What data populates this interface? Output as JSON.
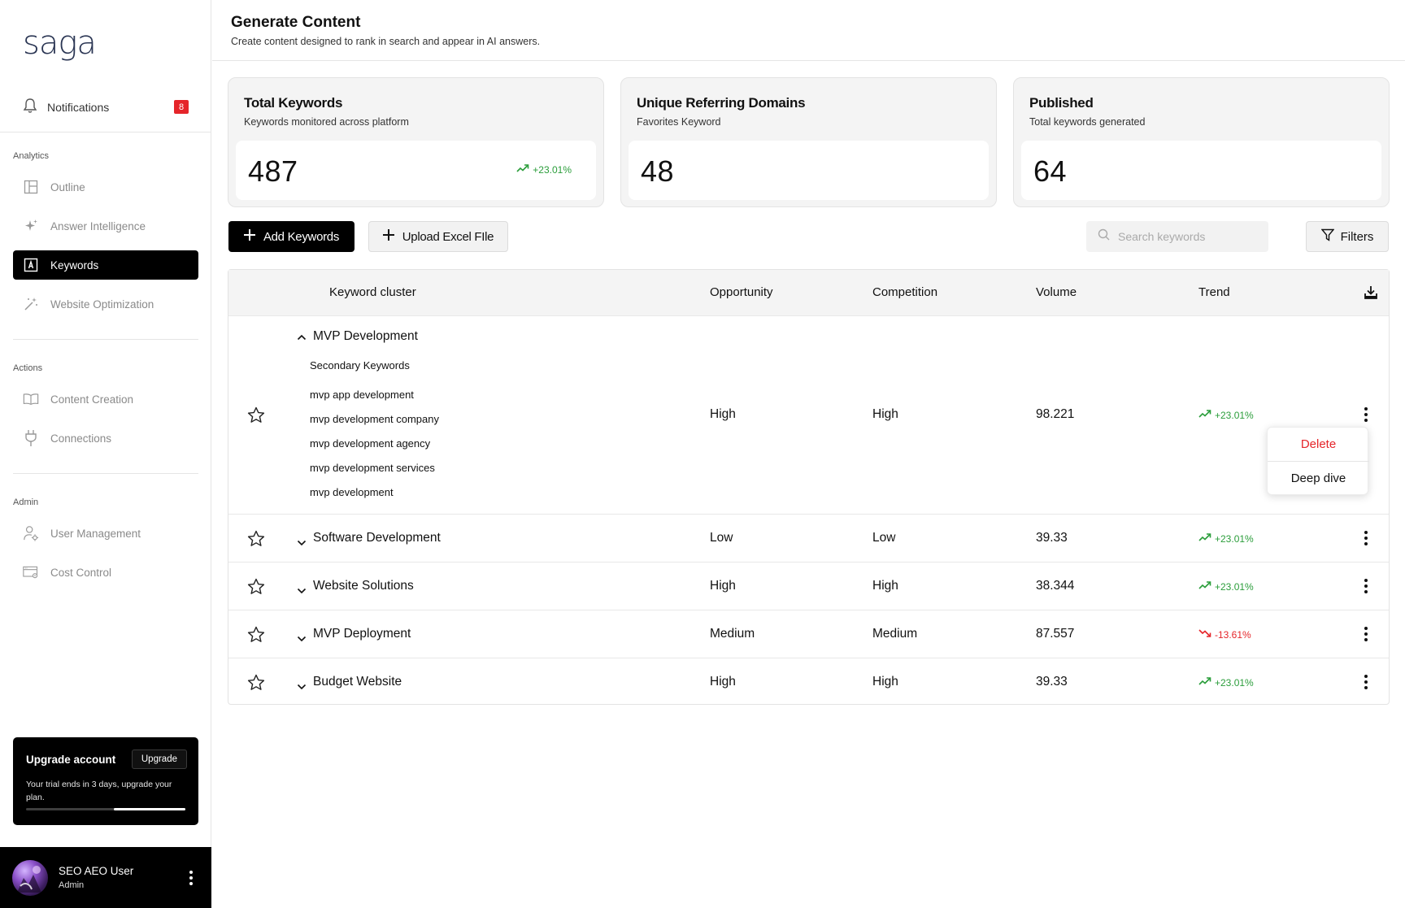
{
  "brand": {
    "logo": "saga"
  },
  "sidebar": {
    "notifications": {
      "label": "Notifications",
      "count": "8"
    },
    "sections": {
      "analytics": "Analytics",
      "actions": "Actions",
      "admin": "Admin"
    },
    "items": [
      {
        "label": "Outline",
        "icon": "layout-icon"
      },
      {
        "label": "Answer Intelligence",
        "icon": "sparkle-icon"
      },
      {
        "label": "Keywords",
        "icon": "keyword-icon",
        "active": true
      },
      {
        "label": "Website Optimization",
        "icon": "magic-wand-icon"
      },
      {
        "label": "Content Creation",
        "icon": "book-icon"
      },
      {
        "label": "Connections",
        "icon": "plug-icon"
      },
      {
        "label": "User Management",
        "icon": "user-gear-icon"
      },
      {
        "label": "Cost Control",
        "icon": "billing-icon"
      }
    ],
    "upgrade": {
      "title": "Upgrade account",
      "button": "Upgrade",
      "description": "Your trial ends in 3 days, upgrade your plan.",
      "progress": 0.45
    },
    "user": {
      "name": "SEO AEO User",
      "role": "Admin"
    }
  },
  "header": {
    "title": "Generate Content",
    "subtitle": "Create content designed to rank in search and appear in AI answers."
  },
  "stats": [
    {
      "title": "Total Keywords",
      "subtitle": "Keywords monitored across platform",
      "value": "487",
      "change": "+23.01%"
    },
    {
      "title": "Unique Referring Domains",
      "subtitle": "Favorites Keyword",
      "value": "48"
    },
    {
      "title": "Published",
      "subtitle": "Total keywords generated",
      "value": "64"
    }
  ],
  "toolbar": {
    "add_keywords": "Add Keywords",
    "upload_excel": "Upload Excel FIle",
    "search_placeholder": "Search keywords",
    "filters": "Filters"
  },
  "table": {
    "columns": [
      "Keyword cluster",
      "Opportunity",
      "Competition",
      "Volume",
      "Trend"
    ],
    "secondary_label": "Secondary Keywords",
    "rows": [
      {
        "name": "MVP Development",
        "opportunity": "High",
        "competition": "High",
        "volume": "98.221",
        "trend": "+23.01%",
        "direction": "up",
        "expanded": true,
        "secondary": [
          "mvp app development",
          "mvp development company",
          "mvp development agency",
          "mvp development services",
          "mvp development"
        ]
      },
      {
        "name": "Software Development",
        "opportunity": "Low",
        "competition": "Low",
        "volume": "39.33",
        "trend": "+23.01%",
        "direction": "up"
      },
      {
        "name": "Website Solutions",
        "opportunity": "High",
        "competition": "High",
        "volume": "38.344",
        "trend": "+23.01%",
        "direction": "up"
      },
      {
        "name": "MVP Deployment",
        "opportunity": "Medium",
        "competition": "Medium",
        "volume": "87.557",
        "trend": "-13.61%",
        "direction": "down"
      },
      {
        "name": "Budget Website",
        "opportunity": "High",
        "competition": "High",
        "volume": "39.33",
        "trend": "+23.01%",
        "direction": "up"
      }
    ]
  },
  "context_menu": {
    "delete": "Delete",
    "deep_dive": "Deep dive"
  },
  "colors": {
    "accent": "#000000",
    "positive": "#2a9d3a",
    "negative": "#e5252a",
    "badge": "#e5252a"
  }
}
